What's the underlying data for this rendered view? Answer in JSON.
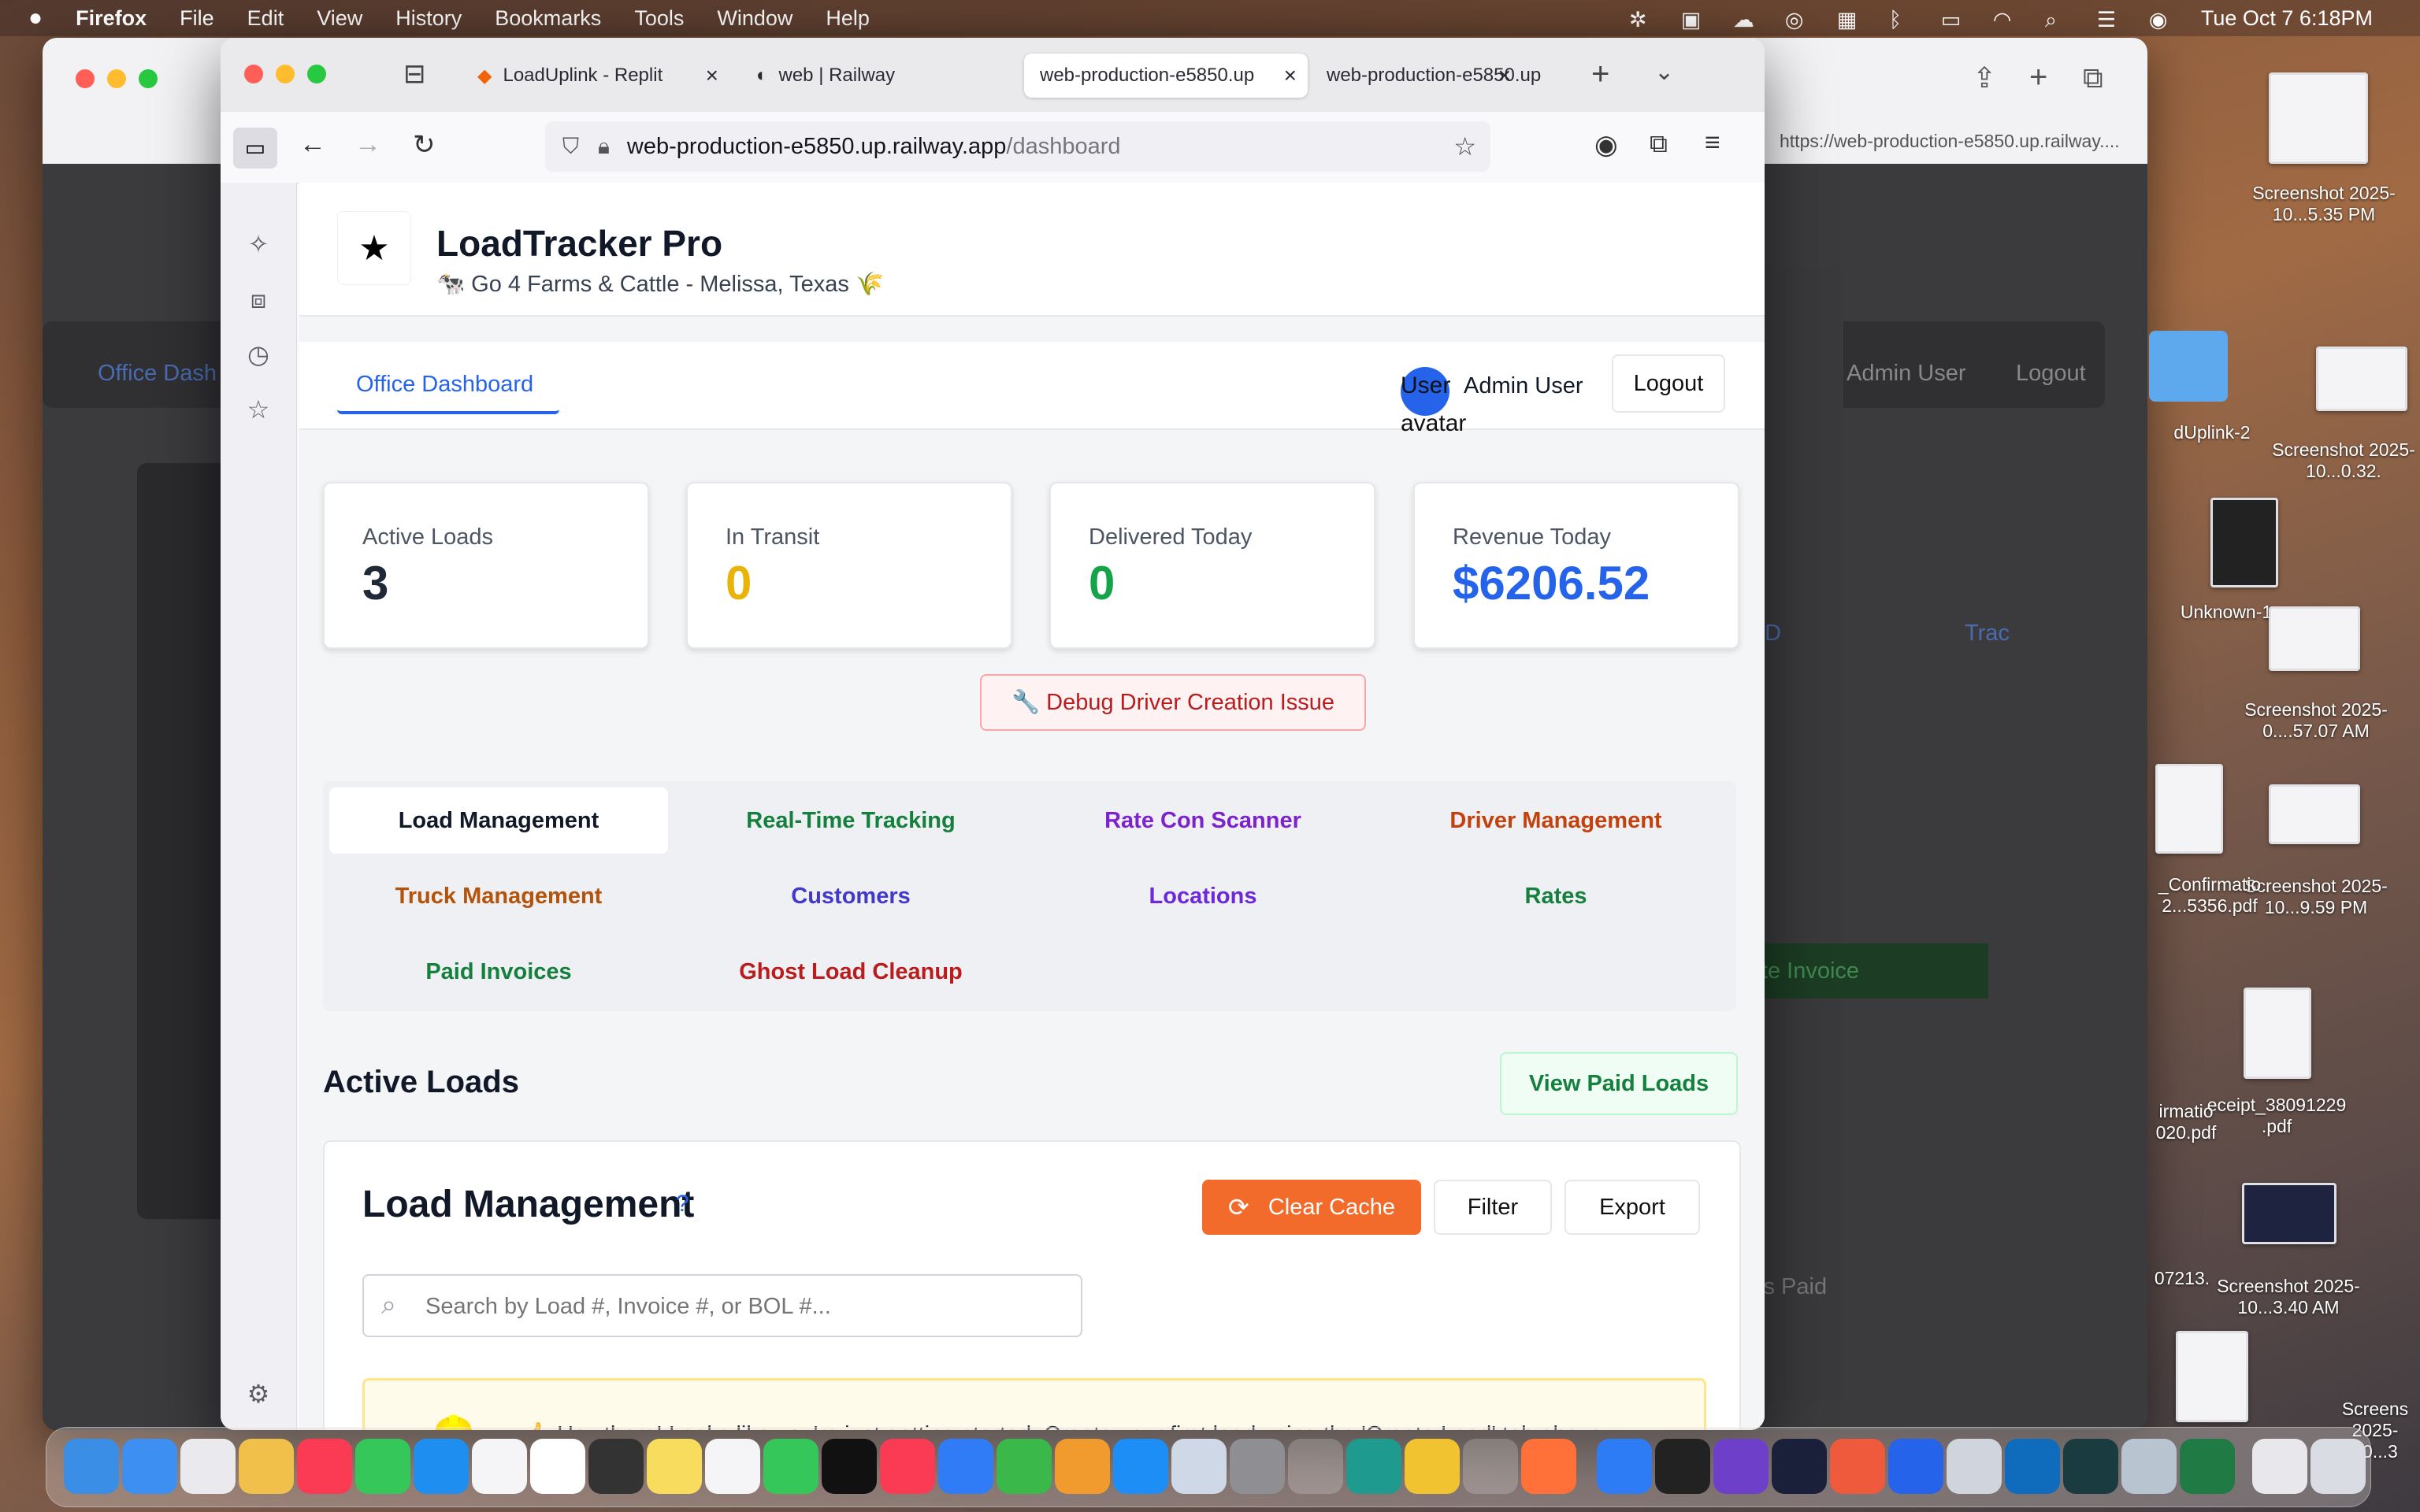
{
  "menubar": {
    "app": "Firefox",
    "items": [
      "File",
      "Edit",
      "View",
      "History",
      "Bookmarks",
      "Tools",
      "Window",
      "Help"
    ],
    "clock": "Tue Oct 7  6:18PM"
  },
  "background_window": {
    "url": "https://web-production-e5850.up.railway....",
    "nav_tab": "Office Dash",
    "user": "Admin User",
    "logout": "Logout",
    "btn_pod": "d POD",
    "btn_track": "Trac",
    "btn_invoice": "erate Invoice",
    "btn_paid": "ark as Paid"
  },
  "browser": {
    "tabs": [
      {
        "label": "LoadUplink - Replit"
      },
      {
        "label": "web | Railway"
      },
      {
        "label": "web-production-e5850.up"
      },
      {
        "label": "web-production-e5850.up"
      }
    ],
    "url_host": "web-production-e5850.up.railway.app",
    "url_path": "/dashboard"
  },
  "app": {
    "title": "LoadTracker Pro",
    "subtitle": "🐄 Go 4 Farms & Cattle - Melissa, Texas 🌾",
    "nav_tab": "Office Dashboard",
    "avatar_alt": "User avatar",
    "user_name": "Admin User",
    "logout": "Logout",
    "stats": [
      {
        "label": "Active Loads",
        "value": "3",
        "color": "#1f2937"
      },
      {
        "label": "In Transit",
        "value": "0",
        "color": "#eab308"
      },
      {
        "label": "Delivered Today",
        "value": "0",
        "color": "#16a34a"
      },
      {
        "label": "Revenue Today",
        "value": "$6206.52",
        "color": "#2563eb"
      }
    ],
    "debug_button": "🔧 Debug Driver Creation Issue",
    "tabs": [
      {
        "label": "Load Management",
        "color": "#111827"
      },
      {
        "label": "Real-Time Tracking",
        "color": "#15803d"
      },
      {
        "label": "Rate Con Scanner",
        "color": "#7e22ce"
      },
      {
        "label": "Driver Management",
        "color": "#c2410c"
      },
      {
        "label": "Truck Management",
        "color": "#b45309"
      },
      {
        "label": "Customers",
        "color": "#4338ca"
      },
      {
        "label": "Locations",
        "color": "#6d28d9"
      },
      {
        "label": "Rates",
        "color": "#15803d"
      },
      {
        "label": "Paid Invoices",
        "color": "#15803d"
      },
      {
        "label": "Ghost Load Cleanup",
        "color": "#b91c1c"
      }
    ],
    "section_title": "Active Loads",
    "view_paid": "View Paid Loads",
    "panel_title": "Load Management",
    "help": "?",
    "clear_cache": "Clear Cache",
    "filter": "Filter",
    "export": "Export",
    "search_placeholder": "Search by Load #, Invoice #, or BOL #...",
    "empty_message": "👍  Hey there! Looks like you're just getting started. Create your first load using the 'Create Load' tab above."
  },
  "desktop": {
    "items": [
      "Screenshot 2025-10...5.35 PM",
      "Screenshot 2025-10...0.32.",
      "dUplink-2",
      "Unknown-1",
      "Screenshot 2025-0....57.07 AM",
      "Screenshot 2025-10...9.59 PM",
      "_Confirmatio 2...5356.pdf",
      "eceipt_38091229 .pdf",
      "irmatio 020.pdf",
      "Screenshot 2025-10...3.40 AM",
      "07213.",
      "Screens 2025-10...3"
    ]
  }
}
